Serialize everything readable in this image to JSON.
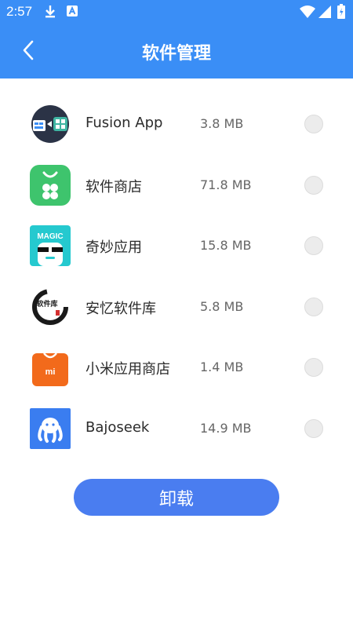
{
  "status_bar": {
    "time": "2:57",
    "icons": [
      "download-icon",
      "notification-a-icon",
      "wifi-icon",
      "signal-icon",
      "battery-icon"
    ]
  },
  "header": {
    "title": "软件管理",
    "back_icon": "chevron-left-icon",
    "background_color": "#3a8ef6"
  },
  "apps": [
    {
      "name": "Fusion App",
      "size": "3.8 MB",
      "icon": "fusion-app-icon",
      "checked": false
    },
    {
      "name": "软件商店",
      "size": "71.8 MB",
      "icon": "software-store-icon",
      "checked": false
    },
    {
      "name": "奇妙应用",
      "size": "15.8 MB",
      "icon": "magic-app-icon",
      "icon_text": "MAGIC",
      "checked": false
    },
    {
      "name": "安忆软件库",
      "size": "5.8 MB",
      "icon": "anyi-library-icon",
      "icon_text": "软件库",
      "checked": false
    },
    {
      "name": "小米应用商店",
      "size": "1.4 MB",
      "icon": "xiaomi-store-icon",
      "icon_text": "mi",
      "checked": false
    },
    {
      "name": "Bajoseek",
      "size": "14.9 MB",
      "icon": "bajoseek-icon",
      "checked": false
    }
  ],
  "actions": {
    "uninstall_label": "卸载",
    "button_color": "#4a7df0"
  }
}
